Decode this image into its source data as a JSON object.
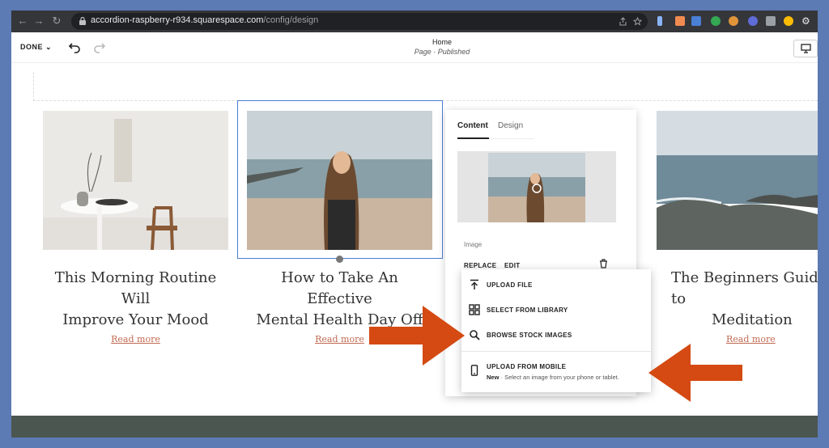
{
  "browser": {
    "url_host": "accordion-raspberry-r934.squarespace.com",
    "url_path": "/config/design"
  },
  "topbar": {
    "done_label": "DONE",
    "page_name": "Home",
    "page_status": "Page · Published"
  },
  "cards": [
    {
      "title_line1": "This Morning Routine Will",
      "title_line2": "Improve Your Mood",
      "read_more": "Read more"
    },
    {
      "title_line1": "How to Take An Effective",
      "title_line2": "Mental Health Day Off",
      "read_more": "Read more"
    },
    {
      "title_line1": "The Beginners Guide to",
      "title_line2": "Meditation",
      "read_more": "Read more"
    }
  ],
  "panel": {
    "tab_content": "Content",
    "tab_design": "Design",
    "image_label": "Image",
    "replace_label": "REPLACE",
    "edit_label": "EDIT"
  },
  "upload_menu": {
    "items": [
      {
        "label": "UPLOAD FILE"
      },
      {
        "label": "SELECT FROM LIBRARY"
      },
      {
        "label": "BROWSE STOCK IMAGES"
      },
      {
        "label": "UPLOAD FROM MOBILE",
        "badge": "New",
        "description": "· Select an image from your phone or tablet."
      }
    ]
  },
  "colors": {
    "accent": "#4a7fd6",
    "arrow": "#d44a12",
    "link": "#c16a52"
  }
}
